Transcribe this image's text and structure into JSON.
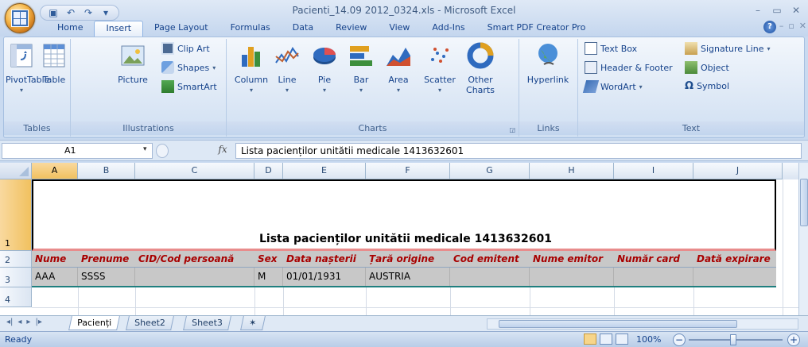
{
  "window": {
    "title": "Pacienti_14.09 2012_0324.xls - Microsoft Excel"
  },
  "tabs": [
    {
      "label": "Home"
    },
    {
      "label": "Insert"
    },
    {
      "label": "Page Layout"
    },
    {
      "label": "Formulas"
    },
    {
      "label": "Data"
    },
    {
      "label": "Review"
    },
    {
      "label": "View"
    },
    {
      "label": "Add-Ins"
    },
    {
      "label": "Smart PDF Creator Pro"
    }
  ],
  "active_tab": "Insert",
  "ribbon": {
    "tables": {
      "label": "Tables",
      "pivot": "PivotTable",
      "table": "Table"
    },
    "illustrations": {
      "label": "Illustrations",
      "picture": "Picture",
      "clipart": "Clip Art",
      "shapes": "Shapes",
      "smartart": "SmartArt"
    },
    "charts": {
      "label": "Charts",
      "column": "Column",
      "line": "Line",
      "pie": "Pie",
      "bar": "Bar",
      "area": "Area",
      "scatter": "Scatter",
      "other": "Other Charts"
    },
    "links": {
      "label": "Links",
      "hyperlink": "Hyperlink"
    },
    "text": {
      "label": "Text",
      "textbox": "Text Box",
      "header_footer": "Header & Footer",
      "wordart": "WordArt",
      "signature": "Signature Line",
      "object": "Object",
      "symbol": "Symbol"
    }
  },
  "formula_bar": {
    "name_box": "A1",
    "fx": "fx",
    "value": "Lista pacienților unitătii medicale 1413632601"
  },
  "grid": {
    "columns": [
      "A",
      "B",
      "C",
      "D",
      "E",
      "F",
      "G",
      "H",
      "I",
      "J"
    ],
    "rows": [
      "1",
      "2",
      "3",
      "4"
    ],
    "title": "Lista pacienților unitătii medicale 1413632601",
    "headers": [
      "Nume",
      "Prenume",
      "CID/Cod persoană",
      "Sex",
      "Data nașterii",
      "Țară origine",
      "Cod emitent",
      "Nume emitor",
      "Număr card",
      "Dată expirare"
    ],
    "record": [
      "AAA",
      "SSSS",
      "",
      "M",
      "01/01/1931",
      "AUSTRIA",
      "",
      "",
      "",
      ""
    ]
  },
  "sheets": {
    "tabs": [
      "Pacienți",
      "Sheet2",
      "Sheet3"
    ],
    "active": "Pacienți"
  },
  "status": {
    "ready": "Ready",
    "zoom": "100%"
  }
}
